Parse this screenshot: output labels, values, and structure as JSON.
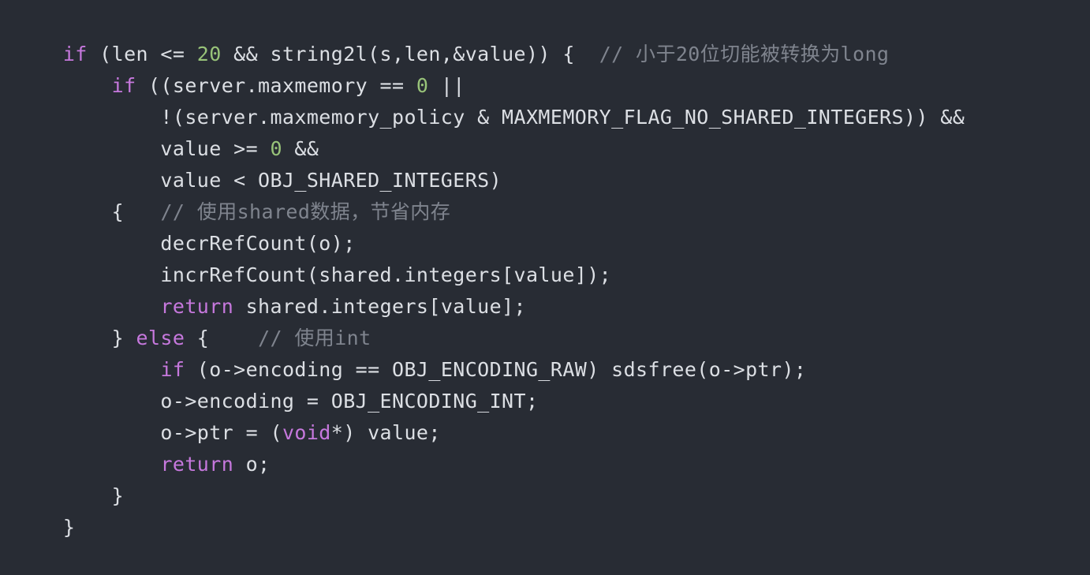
{
  "colors": {
    "background": "#282c34",
    "text": "#dcdfe4",
    "keyword": "#c678dd",
    "number": "#98c379",
    "comment": "#7f848e"
  },
  "lines": [
    [
      {
        "k": "kw",
        "t": "if"
      },
      {
        "k": "tx",
        "t": " (len <= "
      },
      {
        "k": "num",
        "t": "20"
      },
      {
        "k": "tx",
        "t": " && string2l(s,len,&value)) {  "
      },
      {
        "k": "cm",
        "t": "// 小于20位切能被转换为long"
      }
    ],
    [
      {
        "k": "tx",
        "t": "    "
      },
      {
        "k": "kw",
        "t": "if"
      },
      {
        "k": "tx",
        "t": " ((server.maxmemory == "
      },
      {
        "k": "num",
        "t": "0"
      },
      {
        "k": "tx",
        "t": " ||"
      }
    ],
    [
      {
        "k": "tx",
        "t": "        !(server.maxmemory_policy & MAXMEMORY_FLAG_NO_SHARED_INTEGERS)) &&"
      }
    ],
    [
      {
        "k": "tx",
        "t": "        value >= "
      },
      {
        "k": "num",
        "t": "0"
      },
      {
        "k": "tx",
        "t": " &&"
      }
    ],
    [
      {
        "k": "tx",
        "t": "        value < OBJ_SHARED_INTEGERS)"
      }
    ],
    [
      {
        "k": "tx",
        "t": "    {   "
      },
      {
        "k": "cm",
        "t": "// 使用shared数据，节省内存"
      }
    ],
    [
      {
        "k": "tx",
        "t": "        decrRefCount(o);"
      }
    ],
    [
      {
        "k": "tx",
        "t": "        incrRefCount(shared.integers[value]);"
      }
    ],
    [
      {
        "k": "tx",
        "t": "        "
      },
      {
        "k": "kw",
        "t": "return"
      },
      {
        "k": "tx",
        "t": " shared.integers[value];"
      }
    ],
    [
      {
        "k": "tx",
        "t": "    } "
      },
      {
        "k": "kw",
        "t": "else"
      },
      {
        "k": "tx",
        "t": " {    "
      },
      {
        "k": "cm",
        "t": "// 使用int"
      }
    ],
    [
      {
        "k": "tx",
        "t": "        "
      },
      {
        "k": "kw",
        "t": "if"
      },
      {
        "k": "tx",
        "t": " (o->encoding == OBJ_ENCODING_RAW) sdsfree(o->ptr);"
      }
    ],
    [
      {
        "k": "tx",
        "t": "        o->encoding = OBJ_ENCODING_INT;"
      }
    ],
    [
      {
        "k": "tx",
        "t": "        o->ptr = ("
      },
      {
        "k": "kw",
        "t": "void"
      },
      {
        "k": "tx",
        "t": "*) value;"
      }
    ],
    [
      {
        "k": "tx",
        "t": "        "
      },
      {
        "k": "kw",
        "t": "return"
      },
      {
        "k": "tx",
        "t": " o;"
      }
    ],
    [
      {
        "k": "tx",
        "t": "    }"
      }
    ],
    [
      {
        "k": "tx",
        "t": "}"
      }
    ]
  ]
}
